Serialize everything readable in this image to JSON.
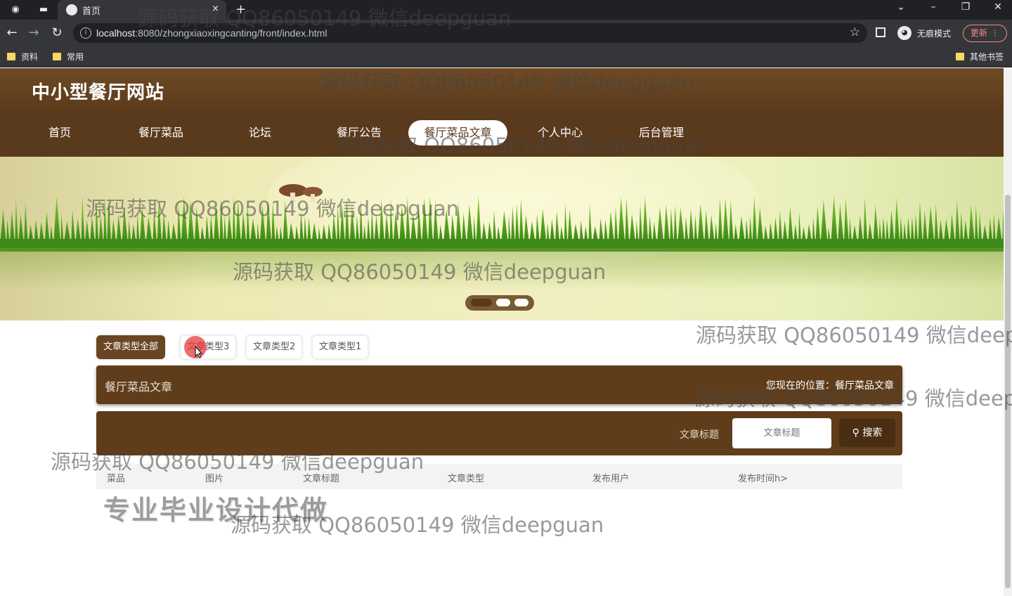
{
  "browser": {
    "tab_title": "首页",
    "tab_close": "×",
    "new_tab": "+",
    "url_host": "localhost",
    "url_rest": ":8080/zhongxiaoxingcanting/front/index.html",
    "incognito_label": "无痕模式",
    "update_label": "更新",
    "bookmarks": [
      "资料",
      "常用"
    ],
    "other_bookmarks": "其他书签"
  },
  "site": {
    "title": "中小型餐厅网站",
    "nav": [
      "首页",
      "餐厅菜品",
      "论坛",
      "餐厅公告",
      "餐厅菜品文章",
      "个人中心",
      "后台管理"
    ],
    "active_nav": "餐厅菜品文章"
  },
  "banner": {
    "slide_count": 3,
    "active_slide": 1
  },
  "filters": [
    "文章类型全部",
    "文章类型3",
    "文章类型2",
    "文章类型1"
  ],
  "breadcrumb": {
    "title": "餐厅菜品文章",
    "location": "您现在的位置：餐厅菜品文章"
  },
  "search": {
    "label": "文章标题",
    "placeholder": "文章标题",
    "button": "搜索"
  },
  "table": {
    "headers": [
      "菜品",
      "图片",
      "文章标题",
      "文章类型",
      "发布用户",
      "发布时间h>"
    ]
  },
  "promo_text": "专业毕业设计代做",
  "watermark_text": "源码获取 QQ86050149 微信deepguan",
  "colors": {
    "brand_brown": "#5f3d1b",
    "header_brown": "#6e4a25",
    "active_filter": "#6a4522"
  }
}
